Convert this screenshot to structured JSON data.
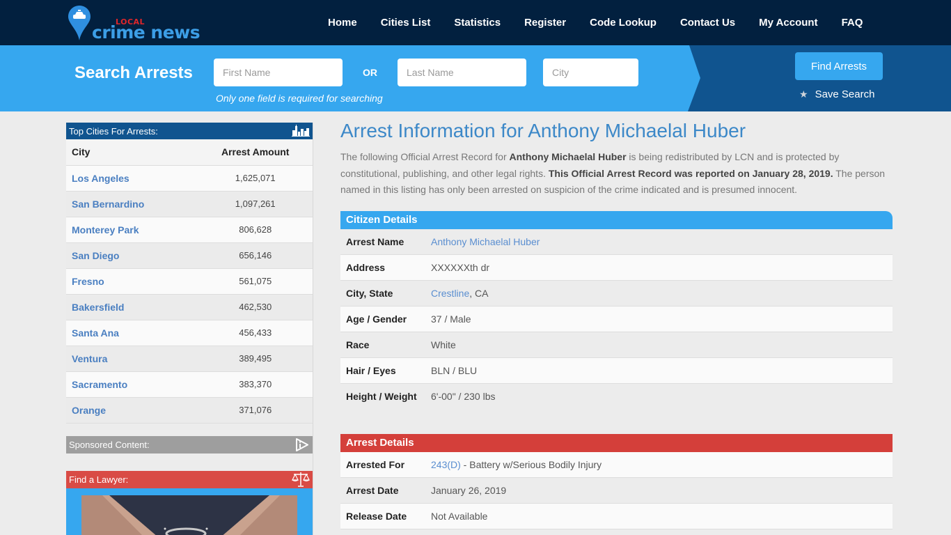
{
  "header": {
    "logo": {
      "top": "LOCAL",
      "main": "crime news",
      "pin_icon": "police-car-map-pin"
    },
    "nav": [
      "Home",
      "Cities List",
      "Statistics",
      "Register",
      "Code Lookup",
      "Contact Us",
      "My Account",
      "FAQ"
    ]
  },
  "search": {
    "title": "Search Arrests",
    "first_name_placeholder": "First Name",
    "or_label": "OR",
    "last_name_placeholder": "Last Name",
    "city_placeholder": "City",
    "hint": "Only one field is required for searching",
    "find_button": "Find Arrests",
    "save_search": "Save Search",
    "save_icon": "star"
  },
  "sidebar": {
    "top_cities_title": "Top Cities For Arrests:",
    "top_cities_icon": "city-skyline",
    "columns": [
      "City",
      "Arrest Amount"
    ],
    "cities": [
      {
        "name": "Los Angeles",
        "amount": "1,625,071"
      },
      {
        "name": "San Bernardino",
        "amount": "1,097,261"
      },
      {
        "name": "Monterey Park",
        "amount": "806,628"
      },
      {
        "name": "San Diego",
        "amount": "656,146"
      },
      {
        "name": "Fresno",
        "amount": "561,075"
      },
      {
        "name": "Bakersfield",
        "amount": "462,530"
      },
      {
        "name": "Santa Ana",
        "amount": "456,433"
      },
      {
        "name": "Ventura",
        "amount": "389,495"
      },
      {
        "name": "Sacramento",
        "amount": "383,370"
      },
      {
        "name": "Orange",
        "amount": "371,076"
      }
    ],
    "sponsored_title": "Sponsored Content:",
    "sponsored_icon": "ad-choices",
    "lawyer_title": "Find a Lawyer:",
    "lawyer_icon": "scales-of-justice",
    "colors": {
      "header_blue": "#10548f",
      "sponsored_gray": "#9e9e9e",
      "lawyer_red": "#d94b45"
    }
  },
  "main": {
    "title": "Arrest Information for Anthony Michaelal Huber",
    "intro": {
      "p1": "The following Official Arrest Record for ",
      "name": "Anthony Michaelal Huber",
      "p2": " is being redistributed by LCN and is protected by constitutional, publishing, and other legal rights. ",
      "reported": "This Official Arrest Record was reported on January 28, 2019.",
      "p3": " The person named in this listing has only been arrested on suspicion of the crime indicated and is presumed innocent."
    },
    "citizen_details": {
      "title": "Citizen Details",
      "arrest_name_label": "Arrest Name",
      "arrest_name": "Anthony Michaelal Huber",
      "address_label": "Address",
      "address": "XXXXXXth dr",
      "city_state_label": "City, State",
      "city": "Crestline",
      "state": ", CA",
      "age_gender_label": "Age / Gender",
      "age_gender": "37 / Male",
      "race_label": "Race",
      "race": "White",
      "hair_eyes_label": "Hair / Eyes",
      "hair_eyes": "BLN / BLU",
      "height_weight_label": "Height / Weight",
      "height_weight": "6'-00\" / 230 lbs"
    },
    "arrest_details": {
      "title": "Arrest Details",
      "arrested_for_label": "Arrested For",
      "code": "243(D)",
      "charge": " - Battery w/Serious Bodily Injury",
      "arrest_date_label": "Arrest Date",
      "arrest_date": "January 26, 2019",
      "release_date_label": "Release Date",
      "release_date": "Not Available"
    },
    "colors": {
      "title_blue": "#3c88c8",
      "citizen_blue": "#36a7ef",
      "arrest_red": "#d43f3a"
    }
  }
}
